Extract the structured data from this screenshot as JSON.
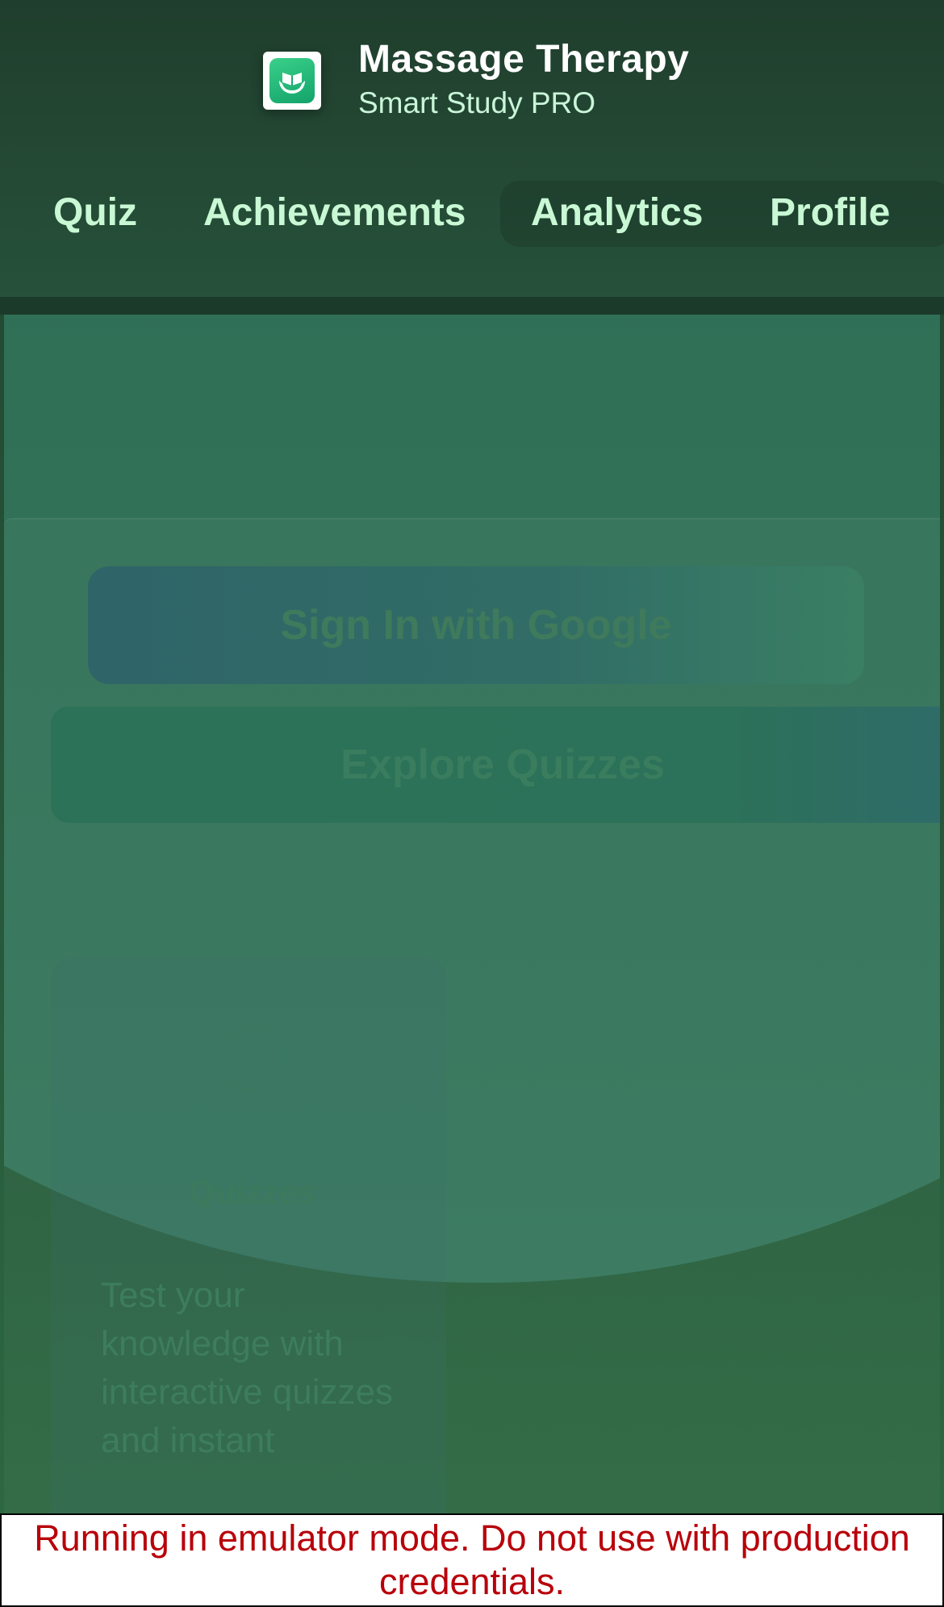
{
  "header": {
    "title": "Massage Therapy",
    "subtitle": "Smart Study PRO",
    "logo_icon": "hands-book-icon"
  },
  "nav": {
    "items": [
      {
        "label": "Quiz"
      },
      {
        "label": "Achievements"
      },
      {
        "label": "Analytics"
      },
      {
        "label": "Profile"
      }
    ]
  },
  "main": {
    "sign_in_label": "Sign In with Google",
    "explore_label": "Explore Quizzes",
    "feature": {
      "title": "Quizzes",
      "description": "Test your knowledge with interactive quizzes and instant"
    }
  },
  "banner": {
    "text": "Running in emulator mode. Do not use with production credentials."
  },
  "colors": {
    "header_bg": "#21432f",
    "nav_text": "#c8f8d4",
    "banner_text": "#b8000a",
    "logo_green": "#22b877"
  }
}
